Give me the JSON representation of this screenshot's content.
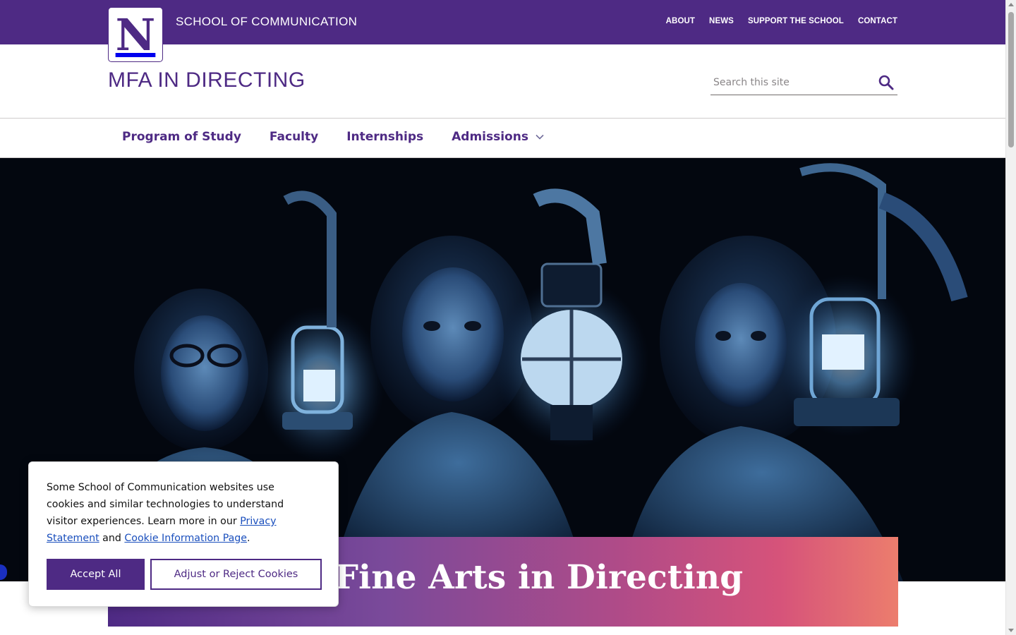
{
  "header": {
    "logo_letter": "N",
    "school_name": "SCHOOL OF COMMUNICATION",
    "top_links": [
      "ABOUT",
      "NEWS",
      "SUPPORT THE SCHOOL",
      "CONTACT"
    ]
  },
  "site": {
    "title": "MFA IN DIRECTING"
  },
  "search": {
    "placeholder": "Search this site",
    "value": ""
  },
  "nav": {
    "items": [
      "Program of Study",
      "Faculty",
      "Internships",
      "Admissions"
    ]
  },
  "hero": {
    "heading": "Master of Fine Arts in Directing"
  },
  "cookie": {
    "text_before": "Some School of Communication websites use cookies and similar technologies to understand visitor experiences. Learn more in our ",
    "privacy_link": "Privacy Statement",
    "text_middle": " and ",
    "cookie_link": "Cookie Information Page",
    "text_after": ".",
    "accept_label": "Accept All",
    "adjust_label": "Adjust or Reject Cookies"
  },
  "colors": {
    "brand_purple": "#4e2a84",
    "link_blue": "#1a4fbd"
  },
  "icons": [
    "search-icon",
    "chevron-down-icon"
  ]
}
